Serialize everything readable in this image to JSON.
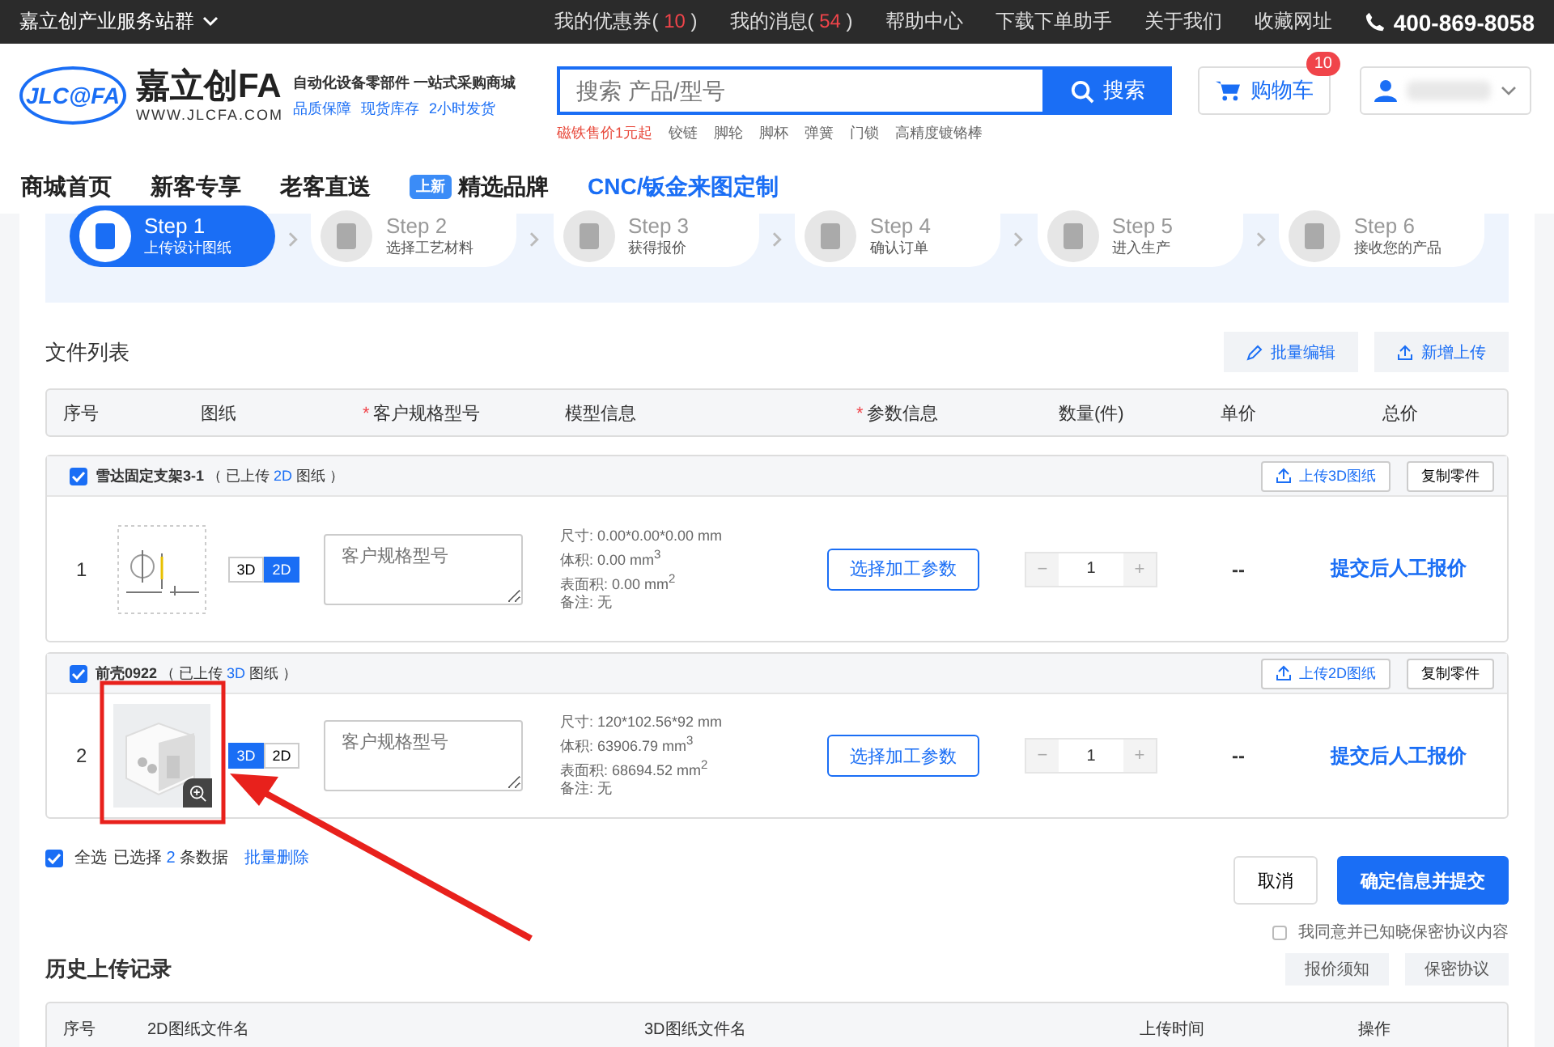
{
  "top_bar": {
    "site_group": "嘉立创产业服务站群",
    "links": [
      {
        "label": "我的优惠券",
        "open": "(",
        "count": "10",
        "close": ")"
      },
      {
        "label": "我的消息",
        "open": "(",
        "count": "54",
        "close": ")"
      },
      {
        "label": "帮助中心"
      },
      {
        "label": "下载下单助手"
      },
      {
        "label": "关于我们"
      },
      {
        "label": "收藏网址"
      }
    ],
    "phone": "400-869-8058"
  },
  "header": {
    "logo_mark": "JLC@FA",
    "brand": "嘉立创FA",
    "domain": "WWW.JLCFA.COM",
    "slogan": "自动化设备零部件 一站式采购商城",
    "promises": [
      "品质保障",
      "现货库存",
      "2小时发货"
    ],
    "search": {
      "placeholder": "搜索 产品/型号",
      "button": "搜索"
    },
    "hot_words": [
      {
        "text": "磁铁售价1元起",
        "hot": true
      },
      {
        "text": "铰链",
        "hot": false
      },
      {
        "text": "脚轮",
        "hot": false
      },
      {
        "text": "脚杯",
        "hot": false
      },
      {
        "text": "弹簧",
        "hot": false
      },
      {
        "text": "门锁",
        "hot": false
      },
      {
        "text": "高精度镀铬棒",
        "hot": false
      }
    ],
    "cart": {
      "label": "购物车",
      "badge": "10"
    }
  },
  "nav": [
    {
      "label": "商城首页",
      "highlight": false
    },
    {
      "label": "新客专享",
      "highlight": false
    },
    {
      "label": "老客直送",
      "highlight": false
    },
    {
      "label": "精选品牌",
      "tag": "上新",
      "highlight": false
    },
    {
      "label": "CNC/钣金来图定制",
      "highlight": true
    }
  ],
  "steps": [
    {
      "step": "Step 1",
      "label": "上传设计图纸",
      "selected": true
    },
    {
      "step": "Step 2",
      "label": "选择工艺材料",
      "selected": false
    },
    {
      "step": "Step 3",
      "label": "获得报价",
      "selected": false
    },
    {
      "step": "Step 4",
      "label": "确认订单",
      "selected": false
    },
    {
      "step": "Step 5",
      "label": "进入生产",
      "selected": false
    },
    {
      "step": "Step 6",
      "label": "接收您的产品",
      "selected": false
    }
  ],
  "file_list": {
    "title": "文件列表",
    "actions": [
      "批量编辑",
      "新增上传"
    ],
    "columns": [
      {
        "label": "序号"
      },
      {
        "label": "图纸"
      },
      {
        "label": "客户规格型号",
        "required_mark": "*"
      },
      {
        "label": "模型信息"
      },
      {
        "label": "参数信息",
        "required_mark": "*"
      },
      {
        "label": "数量(件)"
      },
      {
        "label": "单价"
      },
      {
        "label": "总价"
      }
    ],
    "items": [
      {
        "name": "雪达固定支架3-1",
        "checked": true,
        "note_before": "（ 已上传 ",
        "uploaded": "2D",
        "note_after": " 图纸 ）",
        "upload_button": "上传3D图纸",
        "copy_button": "复制零件",
        "index": "1",
        "kind": "sketch",
        "toggles": [
          {
            "label": "3D",
            "selected": false
          },
          {
            "label": "2D",
            "selected": true
          }
        ],
        "spec_placeholder": "客户规格型号",
        "info": [
          {
            "text": "尺寸: 0.00*0.00*0.00 mm"
          },
          {
            "text": "体积: 0.00 mm$^{3}$"
          },
          {
            "text": "表面积: 0.00 mm$^{2}$"
          },
          {
            "text": "备注: 无"
          }
        ],
        "param_button": "选择加工参数",
        "minus": "−",
        "quantity": "1",
        "plus": "+",
        "unit_price": "--",
        "total": "提交后人工报价"
      },
      {
        "name": "前壳0922",
        "checked": true,
        "note_before": "（ 已上传 ",
        "uploaded": "3D",
        "note_after": " 图纸 ）",
        "upload_button": "上传2D图纸",
        "copy_button": "复制零件",
        "index": "2",
        "kind": "model",
        "toggles": [
          {
            "label": "3D",
            "selected": true
          },
          {
            "label": "2D",
            "selected": false
          }
        ],
        "spec_placeholder": "客户规格型号",
        "info": [
          {
            "text": "尺寸: 120*102.56*92 mm"
          },
          {
            "text": "体积: 63906.79 mm$^{3}$"
          },
          {
            "text": "表面积: 68694.52 mm$^{2}$"
          },
          {
            "text": "备注: 无"
          }
        ],
        "param_button": "选择加工参数",
        "minus": "−",
        "quantity": "1",
        "plus": "+",
        "unit_price": "--",
        "total": "提交后人工报价"
      }
    ],
    "select_all": {
      "checked": true,
      "label": "全选",
      "selected_before": "已选择",
      "selected_count": "2",
      "selected_after": "条数据",
      "bulk_delete": "批量删除"
    },
    "cancel": "取消",
    "submit": "确定信息并提交",
    "agree": {
      "checked": false,
      "label": "我同意并已知晓保密协议内容"
    }
  },
  "history": {
    "title": "历史上传记录",
    "buttons": [
      "报价须知",
      "保密协议"
    ],
    "columns": [
      "序号",
      "2D图纸文件名",
      "3D图纸文件名",
      "上传时间",
      "操作"
    ]
  },
  "annotations": {
    "highlight_box": true,
    "arrow": true
  }
}
